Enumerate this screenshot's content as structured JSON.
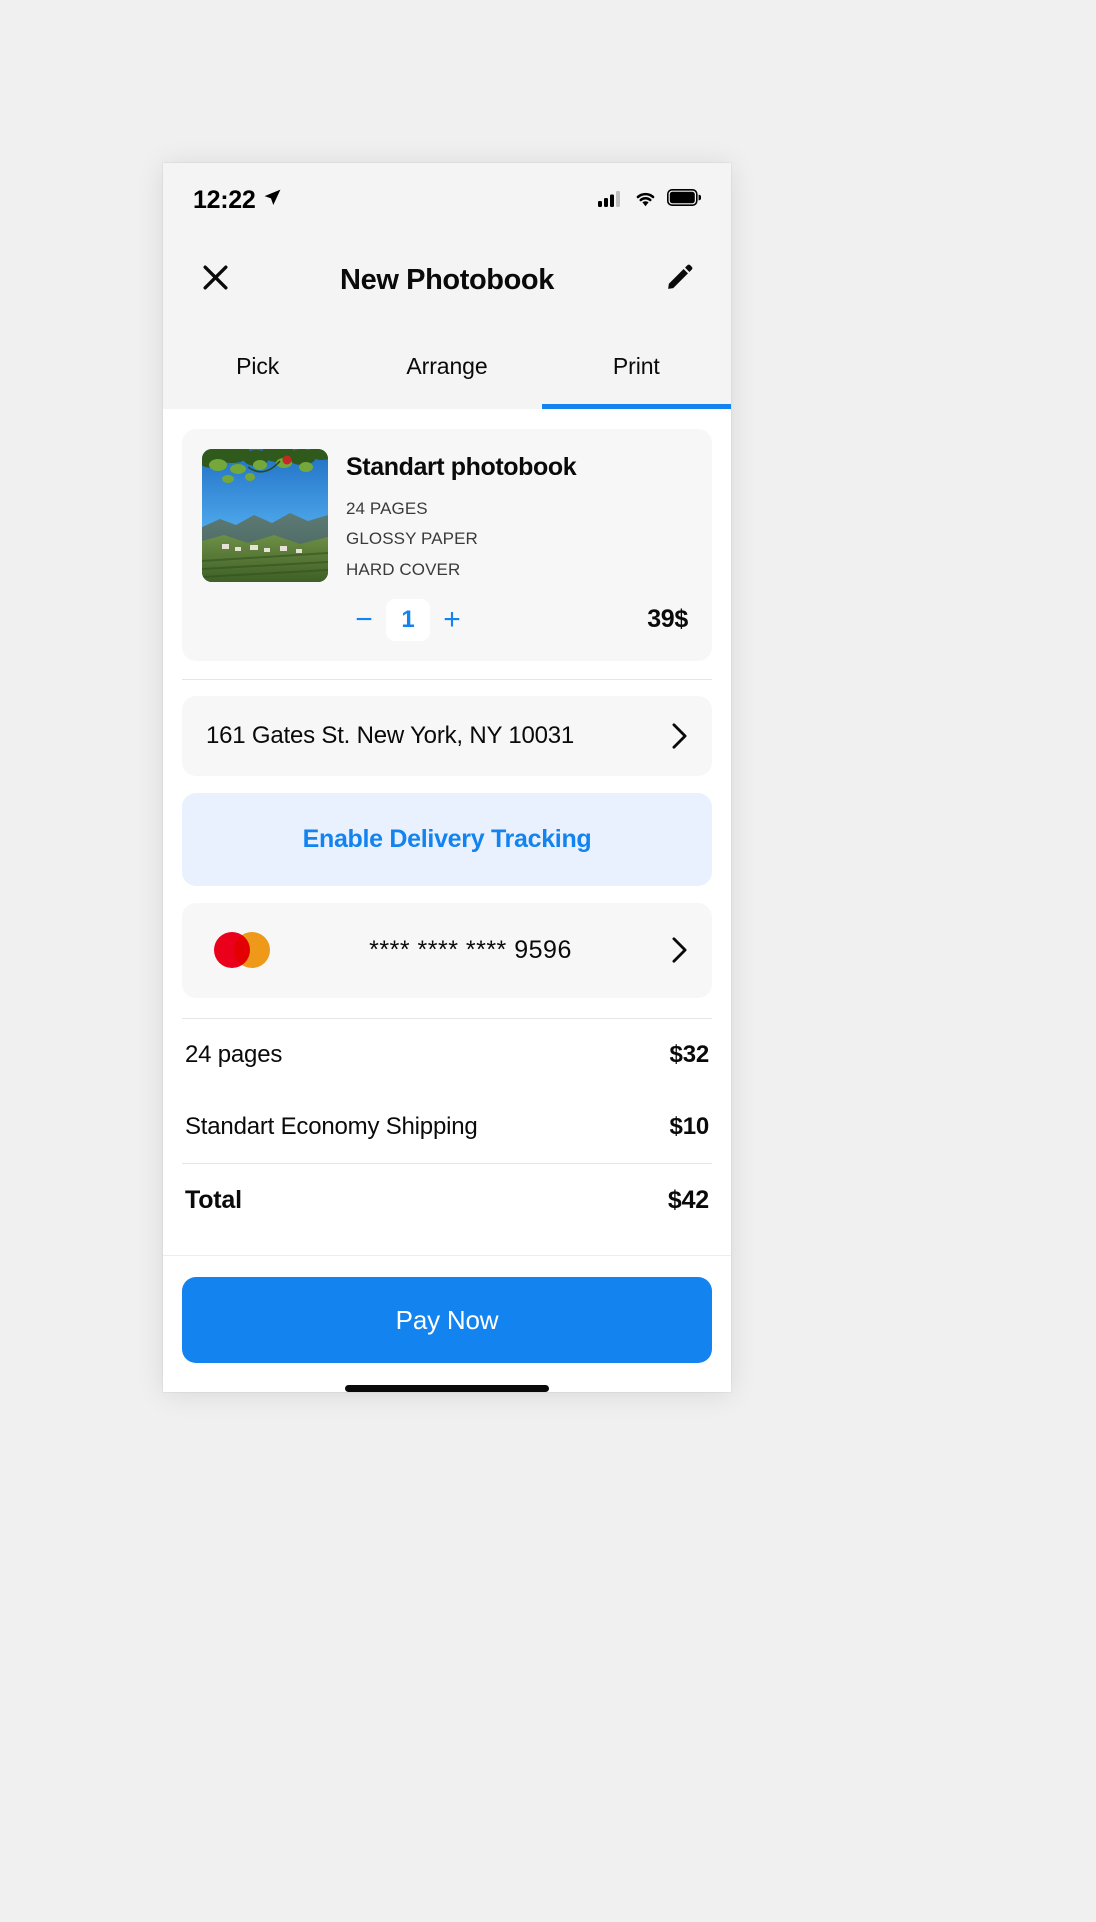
{
  "status_bar": {
    "time": "12:22",
    "location_icon": "location-arrow-icon",
    "cellular_icon": "cellular-signal-icon",
    "wifi_icon": "wifi-icon",
    "battery_icon": "battery-full-icon"
  },
  "navbar": {
    "close_icon": "close-x-icon",
    "title": "New Photobook",
    "edit_icon": "pencil-edit-icon"
  },
  "tabs": [
    {
      "label": "Pick",
      "active": false
    },
    {
      "label": "Arrange",
      "active": false
    },
    {
      "label": "Print",
      "active": true
    }
  ],
  "product": {
    "title": "Standart photobook",
    "thumbnail_alt": "vineyard-landscape-photo",
    "specs": [
      "24 PAGES",
      "GLOSSY PAPER",
      "HARD COVER"
    ],
    "decrement_label": "−",
    "quantity": "1",
    "increment_label": "+",
    "price": "39$"
  },
  "address": {
    "text": "161 Gates St. New York, NY 10031",
    "chevron_icon": "chevron-right-icon"
  },
  "tracking": {
    "label": "Enable Delivery Tracking"
  },
  "payment": {
    "brand_icon": "mastercard-logo",
    "masked_number": "**** **** **** 9596",
    "chevron_icon": "chevron-right-icon"
  },
  "summary": {
    "rows": [
      {
        "label": "24 pages",
        "value": "$32"
      },
      {
        "label": "Standart Economy Shipping",
        "value": "$10"
      }
    ],
    "total": {
      "label": "Total",
      "value": "$42"
    }
  },
  "footer": {
    "pay_label": "Pay Now",
    "home_indicator": "home-indicator"
  },
  "colors": {
    "accent": "#1383f0",
    "tracking_bg": "#e8f1fd",
    "card_bg": "#f7f7f8",
    "mastercard_red": "#eb001b",
    "mastercard_orange": "#f79e1b"
  }
}
